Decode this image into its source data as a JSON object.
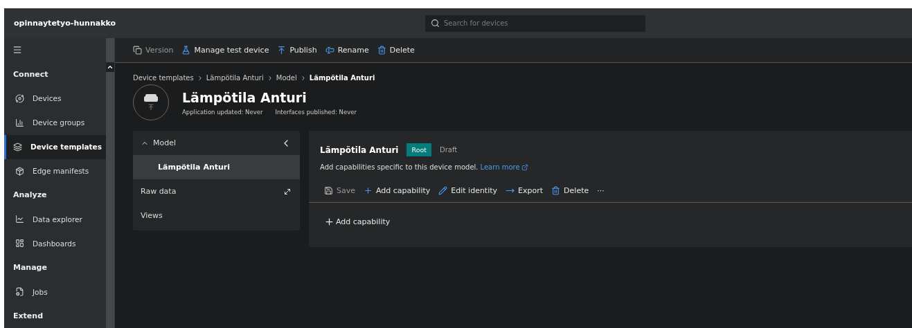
{
  "app_title": "opinnaytetyo-hunnakko",
  "search": {
    "placeholder": "Search for devices"
  },
  "toolbar": [
    {
      "kind": "version",
      "label": "Version",
      "disabled": true
    },
    {
      "kind": "test",
      "label": "Manage test device",
      "disabled": false
    },
    {
      "kind": "publish",
      "label": "Publish",
      "disabled": false
    },
    {
      "kind": "rename",
      "label": "Rename",
      "disabled": false
    },
    {
      "kind": "delete",
      "label": "Delete",
      "disabled": false
    }
  ],
  "sidebar": [
    {
      "section": "Connect",
      "items": [
        {
          "kind": "devices",
          "label": "Devices",
          "selected": false
        },
        {
          "kind": "groups",
          "label": "Device groups",
          "selected": false
        },
        {
          "kind": "templates",
          "label": "Device templates",
          "selected": true
        },
        {
          "kind": "edge",
          "label": "Edge manifests",
          "selected": false
        }
      ]
    },
    {
      "section": "Analyze",
      "items": [
        {
          "kind": "explorer",
          "label": "Data explorer",
          "selected": false
        },
        {
          "kind": "dashboards",
          "label": "Dashboards",
          "selected": false
        }
      ]
    },
    {
      "section": "Manage",
      "items": [
        {
          "kind": "jobs",
          "label": "Jobs",
          "selected": false
        }
      ]
    },
    {
      "section": "Extend"
    }
  ],
  "breadcrumb": [
    {
      "label": "Device templates",
      "current": false
    },
    {
      "label": "Lämpötila Anturi",
      "current": false
    },
    {
      "label": "Model",
      "current": false
    },
    {
      "label": "Lämpötila Anturi",
      "current": true
    }
  ],
  "title": "Lämpötila Anturi",
  "meta": [
    "Application updated: Never",
    "Interfaces published: Never"
  ],
  "tree": [
    {
      "label": "Model",
      "expanded": true,
      "selected": false,
      "children": [
        {
          "label": "Lämpötila Anturi",
          "selected": true
        }
      ]
    },
    {
      "label": "Raw data",
      "selected": false
    },
    {
      "label": "Views",
      "selected": false
    }
  ],
  "model": {
    "name": "Lämpötila Anturi",
    "badge": "Root",
    "status": "Draft",
    "description": "Add capabilities specific to this device model.",
    "link": "Learn more",
    "actions": [
      {
        "kind": "save",
        "label": "Save",
        "disabled": true
      },
      {
        "kind": "add",
        "label": "Add capability",
        "disabled": false
      },
      {
        "kind": "edit",
        "label": "Edit identity",
        "disabled": false
      },
      {
        "kind": "export",
        "label": "Export",
        "disabled": false
      },
      {
        "kind": "delete",
        "label": "Delete",
        "disabled": false
      },
      {
        "kind": "more",
        "label": "···",
        "disabled": false
      }
    ],
    "add_button": "Add capability"
  }
}
